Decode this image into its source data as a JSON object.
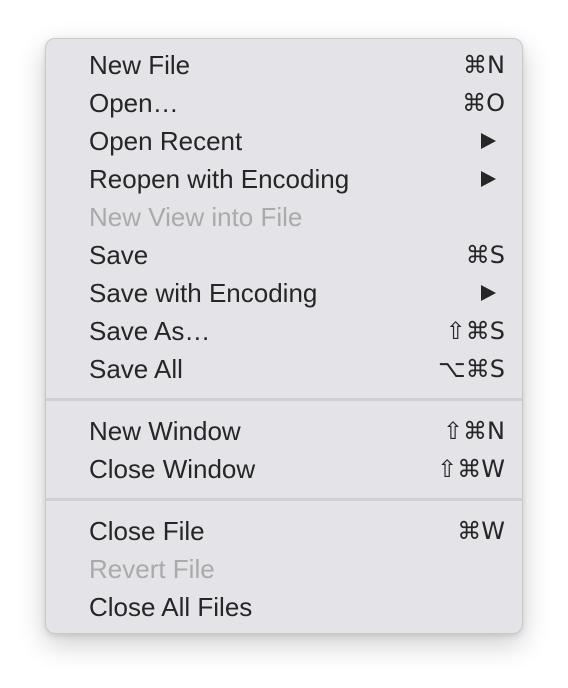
{
  "menu": {
    "items": [
      {
        "label": "New File",
        "shortcut": "⌘N"
      },
      {
        "label": "Open…",
        "shortcut": "⌘O"
      },
      {
        "label": "Open Recent",
        "submenu": true
      },
      {
        "label": "Reopen with Encoding",
        "submenu": true
      },
      {
        "label": "New View into File",
        "disabled": true
      },
      {
        "label": "Save",
        "shortcut": "⌘S"
      },
      {
        "label": "Save with Encoding",
        "submenu": true
      },
      {
        "label": "Save As…",
        "shortcut": "⇧⌘S"
      },
      {
        "label": "Save All",
        "shortcut": "⌥⌘S"
      },
      {
        "label": "New Window",
        "shortcut": "⇧⌘N"
      },
      {
        "label": "Close Window",
        "shortcut": "⇧⌘W"
      },
      {
        "label": "Close File",
        "shortcut": "⌘W"
      },
      {
        "label": "Revert File",
        "disabled": true
      },
      {
        "label": "Close All Files"
      }
    ],
    "submenu_icon": "triangle-right-icon",
    "colors": {
      "background": "#e4e3e7",
      "text": "#262626",
      "disabled_text": "#aaaaab",
      "separator": "#d0cfd3"
    }
  }
}
